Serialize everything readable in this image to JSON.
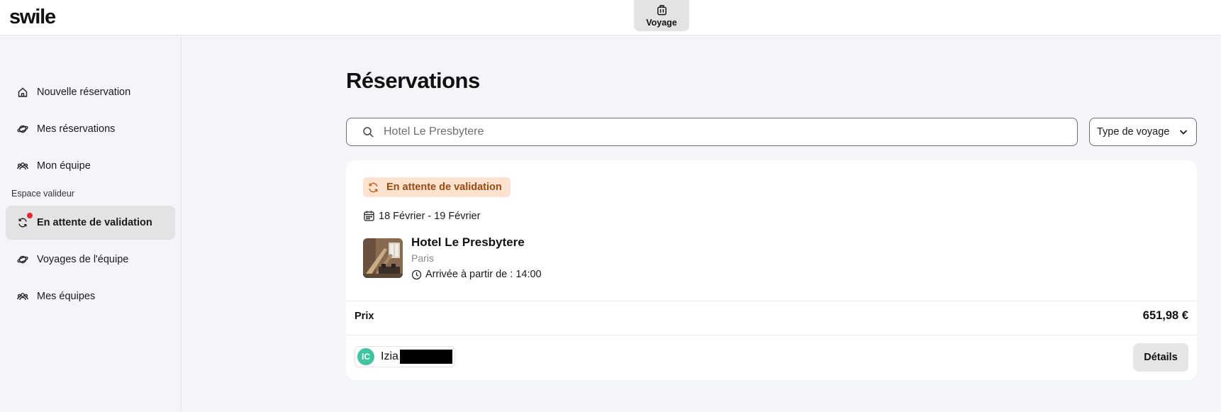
{
  "header": {
    "logo": "swile",
    "app_tab": {
      "label": "Voyage",
      "icon": "luggage-icon"
    }
  },
  "sidebar": {
    "items": [
      {
        "label": "Nouvelle réservation",
        "icon": "home-icon"
      },
      {
        "label": "Mes réservations",
        "icon": "planet-icon"
      },
      {
        "label": "Mon équipe",
        "icon": "team-icon"
      }
    ],
    "section_label": "Espace valideur",
    "validator_items": [
      {
        "label": "En attente de validation",
        "icon": "refresh-icon",
        "active": true,
        "notification_dot": true
      },
      {
        "label": "Voyages de l'équipe",
        "icon": "planet-icon"
      },
      {
        "label": "Mes équipes",
        "icon": "team-icon"
      }
    ]
  },
  "main": {
    "title": "Réservations",
    "search": {
      "value": "",
      "placeholder": "Hotel Le Presbytere"
    },
    "type_filter": {
      "label": "Type de voyage"
    },
    "booking": {
      "status": "En attente de validation",
      "status_color": "#9a4a12",
      "status_bg": "#fde2cf",
      "dates": "18 Février - 19 Février",
      "hotel_name": "Hotel Le Presbytere",
      "city": "Paris",
      "arrival": "Arrivée à partir de : 14:00",
      "price_label": "Prix",
      "price_value": "651,98 €",
      "traveler": {
        "initials": "IC",
        "first_name": "Izia",
        "avatar_color": "#3ec6a3"
      },
      "details_label": "Détails"
    }
  }
}
